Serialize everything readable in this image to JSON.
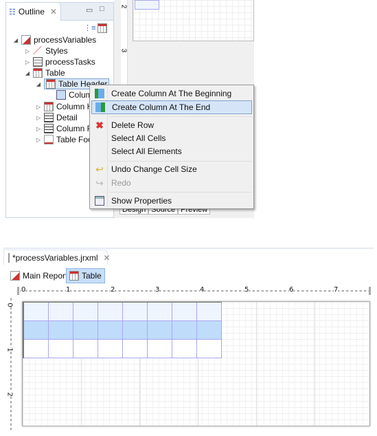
{
  "outline": {
    "tab_label": "Outline",
    "tree": [
      {
        "label": "processVariables",
        "icon": "report-icon"
      },
      {
        "label": "Styles",
        "icon": "styles-brush-icon"
      },
      {
        "label": "processTasks",
        "icon": "dataset-icon"
      },
      {
        "label": "Table",
        "icon": "table-icon"
      },
      {
        "label": "Table Header",
        "icon": "table-header-icon"
      },
      {
        "label": "Colum",
        "icon": "column-icon"
      },
      {
        "label": "Column H",
        "icon": "column-header-icon"
      },
      {
        "label": "Detail",
        "icon": "detail-icon"
      },
      {
        "label": "Column F",
        "icon": "column-footer-icon"
      },
      {
        "label": "Table Foo",
        "icon": "table-footer-icon"
      }
    ]
  },
  "editor_top": {
    "ruler_labels": [
      "2",
      "3"
    ],
    "tabs": [
      "Design",
      "Source",
      "Preview"
    ]
  },
  "context_menu": {
    "items": [
      {
        "label": "Create Column At The Beginning",
        "icon": "column-begin-icon"
      },
      {
        "label": "Create Column At The End",
        "icon": "column-end-icon",
        "highlighted": true
      },
      {
        "label": "Delete Row",
        "icon": "delete-x-icon"
      },
      {
        "label": "Select All Cells"
      },
      {
        "label": "Select All Elements"
      },
      {
        "label": "Undo Change Cell Size",
        "icon": "undo-icon"
      },
      {
        "label": "Redo",
        "icon": "redo-icon",
        "disabled": true
      },
      {
        "label": "Show Properties",
        "icon": "properties-icon"
      }
    ]
  },
  "editor": {
    "file_tab": "*processVariables.jrxml",
    "toolbar": {
      "main_report": "Main Report",
      "table": "Table"
    },
    "hruler_labels": [
      "0",
      "1",
      "2",
      "3",
      "4",
      "5",
      "6",
      "7"
    ],
    "vruler_labels": [
      "0",
      "1",
      "2"
    ],
    "colors": {
      "header_row": "#eef5fe",
      "selected_row": "#bfdcfb",
      "cell_border": "#a9a6ef"
    }
  }
}
